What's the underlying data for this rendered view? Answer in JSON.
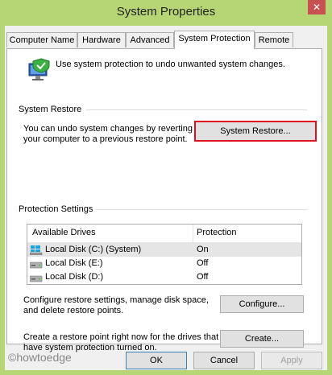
{
  "window": {
    "title": "System Properties",
    "close_glyph": "✕"
  },
  "tabs": [
    {
      "label": "Computer Name"
    },
    {
      "label": "Hardware"
    },
    {
      "label": "Advanced"
    },
    {
      "label": "System Protection"
    },
    {
      "label": "Remote"
    }
  ],
  "intro": {
    "text": "Use system protection to undo unwanted system changes."
  },
  "system_restore": {
    "heading": "System Restore",
    "description_line1": "You can undo system changes by reverting",
    "description_line2": "your computer to a previous restore point.",
    "button_label": "System Restore..."
  },
  "protection_settings": {
    "heading": "Protection Settings",
    "columns": {
      "drive": "Available Drives",
      "protection": "Protection"
    },
    "drives": [
      {
        "name": "Local Disk (C:) (System)",
        "protection": "On",
        "icon": "windows-drive-icon"
      },
      {
        "name": "Local Disk (E:)",
        "protection": "Off",
        "icon": "drive-icon"
      },
      {
        "name": "Local Disk (D:)",
        "protection": "Off",
        "icon": "drive-icon"
      }
    ],
    "configure_text_line1": "Configure restore settings, manage disk space,",
    "configure_text_line2": "and delete restore points.",
    "configure_button": "Configure...",
    "create_text_line1": "Create a restore point right now for the drives that",
    "create_text_line2": "have system protection turned on.",
    "create_button": "Create..."
  },
  "footer": {
    "ok": "OK",
    "cancel": "Cancel",
    "apply": "Apply"
  },
  "watermark": "©howtoedge"
}
